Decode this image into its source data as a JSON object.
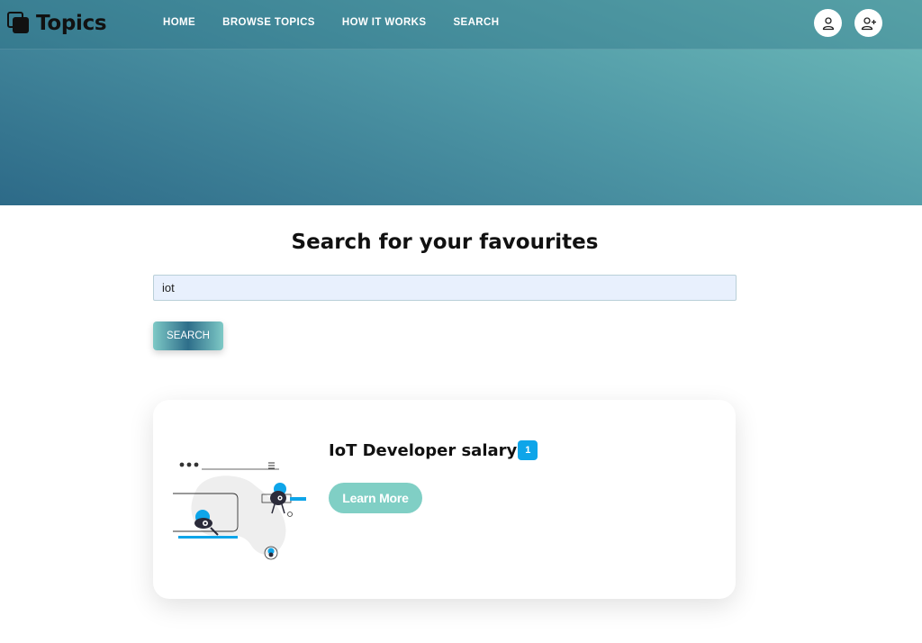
{
  "brand": {
    "name": "Topics"
  },
  "nav": {
    "links": [
      {
        "label": "HOME"
      },
      {
        "label": "BROWSE TOPICS"
      },
      {
        "label": "HOW IT WORKS"
      },
      {
        "label": "SEARCH"
      }
    ],
    "icons": {
      "login": "user-icon",
      "register": "user-plus-icon"
    }
  },
  "search": {
    "title": "Search for your favourites",
    "input_value": "iot",
    "button_label": "SEARCH"
  },
  "results": [
    {
      "title": "IoT Developer salary",
      "badge": "1",
      "button_label": "Learn More",
      "illustration": "search-illustration"
    }
  ],
  "colors": {
    "hero_light": "#6fbcba",
    "hero_dark": "#2d6a88",
    "badge": "#0ea5e9",
    "learn_more": "#80cfc5",
    "input_bg": "#e8f0fd"
  }
}
